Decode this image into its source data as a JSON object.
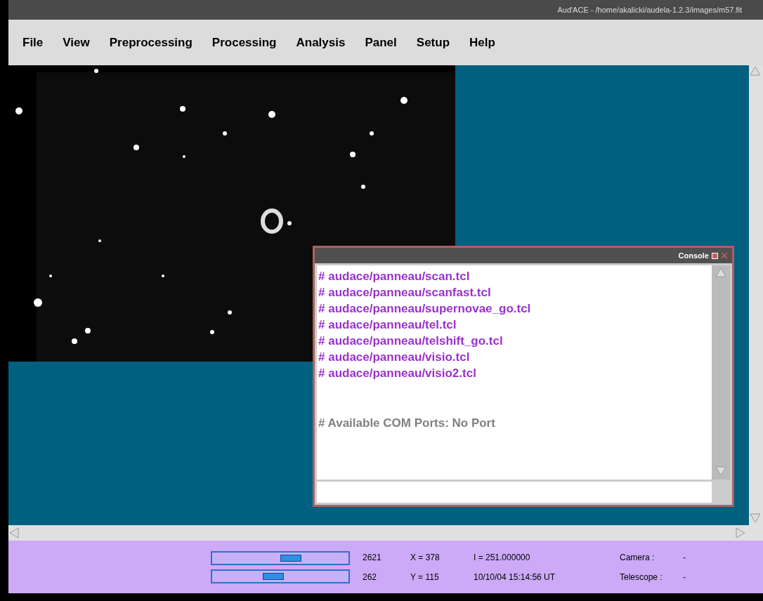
{
  "window": {
    "title": "Aud'ACE - /home/akalicki/audela-1.2.3/images/m57.fit"
  },
  "menu": [
    "File",
    "View",
    "Preprocessing",
    "Processing",
    "Analysis",
    "Panel",
    "Setup",
    "Help"
  ],
  "console": {
    "title": "Console",
    "lines": [
      {
        "kind": "file",
        "text": "# audace/panneau/scan.tcl"
      },
      {
        "kind": "file",
        "text": "# audace/panneau/scanfast.tcl"
      },
      {
        "kind": "file",
        "text": "# audace/panneau/supernovae_go.tcl"
      },
      {
        "kind": "file",
        "text": "# audace/panneau/tel.tcl"
      },
      {
        "kind": "file",
        "text": "# audace/panneau/telshift_go.tcl"
      },
      {
        "kind": "file",
        "text": "# audace/panneau/visio.tcl"
      },
      {
        "kind": "file",
        "text": "# audace/panneau/visio2.tcl"
      },
      {
        "kind": "info",
        "text": "# Available COM Ports: No Port"
      }
    ]
  },
  "status": {
    "sliders": [
      {
        "level": 0.58,
        "value": "2621"
      },
      {
        "level": 0.43,
        "value": "262"
      }
    ],
    "coords": [
      "X = 378",
      "Y = 115"
    ],
    "intensity": "I = 251.000000",
    "datetime": "10/10/04 15:14:56 UT",
    "camera": {
      "label": "Camera :",
      "value": "-"
    },
    "telescope": {
      "label": "Telescope :",
      "value": "-"
    }
  }
}
